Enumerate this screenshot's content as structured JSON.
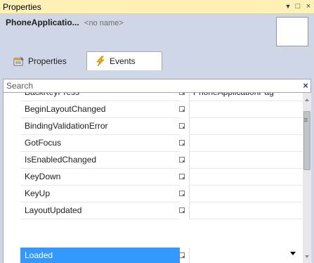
{
  "window": {
    "title": "Properties",
    "buttons": {
      "dropdown": "▼",
      "maximize": "□",
      "close": "×"
    }
  },
  "header": {
    "object_name": "PhoneApplicatio...",
    "object_subname": "<no name>"
  },
  "tabs": [
    {
      "label": "Properties",
      "icon": "properties-icon",
      "active": false
    },
    {
      "label": "Events",
      "icon": "lightning-icon",
      "active": true
    }
  ],
  "search": {
    "placeholder": "Search",
    "value": "",
    "clear_glyph": "×"
  },
  "events": [
    {
      "name": "BackKeyPress",
      "handler": "PhoneApplicationPag"
    },
    {
      "name": "BeginLayoutChanged",
      "handler": ""
    },
    {
      "name": "BindingValidationError",
      "handler": ""
    },
    {
      "name": "GotFocus",
      "handler": ""
    },
    {
      "name": "IsEnabledChanged",
      "handler": ""
    },
    {
      "name": "KeyDown",
      "handler": ""
    },
    {
      "name": "KeyUp",
      "handler": ""
    },
    {
      "name": "LayoutUpdated",
      "handler": ""
    },
    {
      "name": "Loaded",
      "handler": ""
    }
  ],
  "selected_event": "Loaded",
  "colors": {
    "title_bar": "#fff1b7",
    "panel_bg": "#cfd6e5",
    "selection": "#3399ff"
  }
}
